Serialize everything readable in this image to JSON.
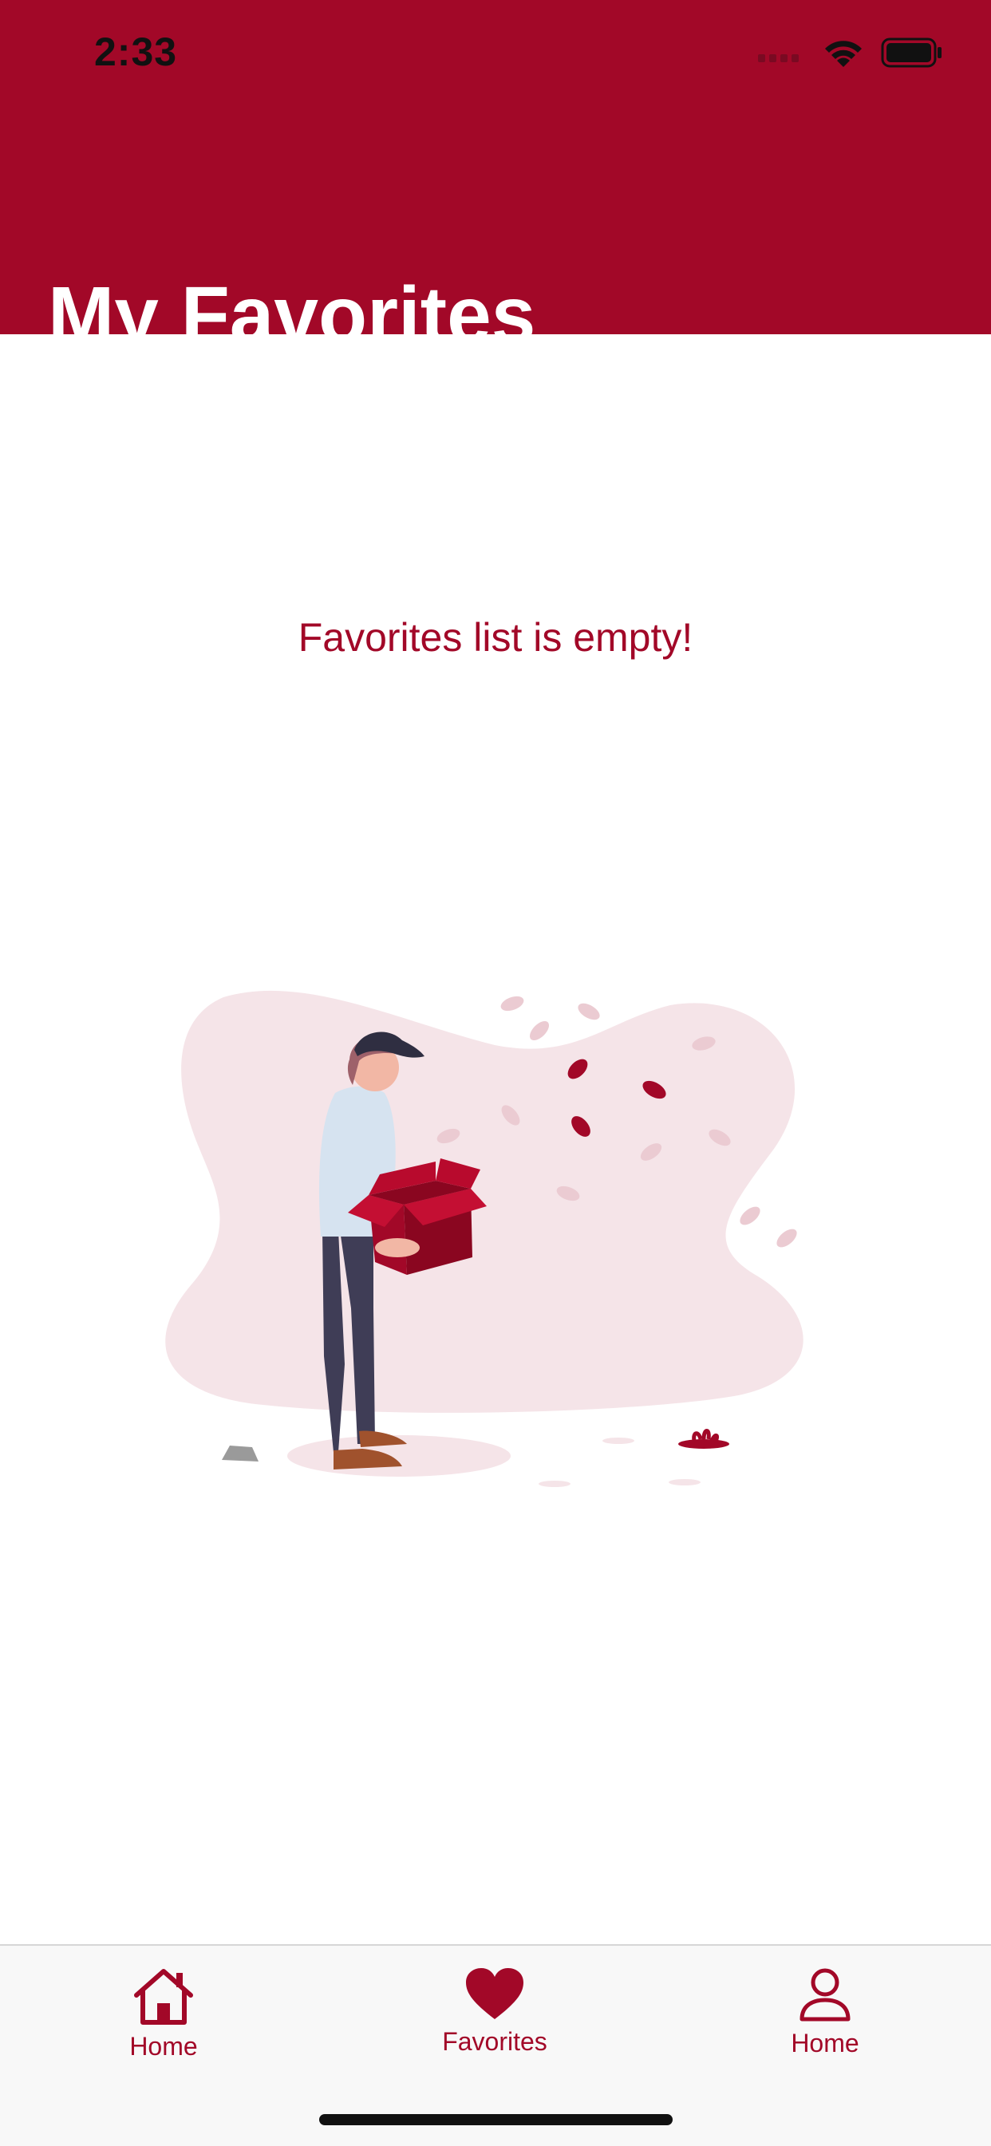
{
  "status_bar": {
    "time": "2:33",
    "icons": [
      "signal-icon",
      "wifi-icon",
      "battery-icon"
    ]
  },
  "header": {
    "title": "My Favorites"
  },
  "main": {
    "empty_message": "Favorites list is empty!",
    "illustration": "empty-box-illustration"
  },
  "tabbar": {
    "tabs": [
      {
        "label": "Home",
        "icon": "house-icon",
        "active": false
      },
      {
        "label": "Favorites",
        "icon": "heart-icon",
        "active": true
      },
      {
        "label": "Home",
        "icon": "person-icon",
        "active": false
      }
    ]
  },
  "colors": {
    "primary": "#a20828",
    "background": "#ffffff",
    "tabbar_bg": "#f8f8f8",
    "illustration_blob": "#f5e4e8"
  }
}
